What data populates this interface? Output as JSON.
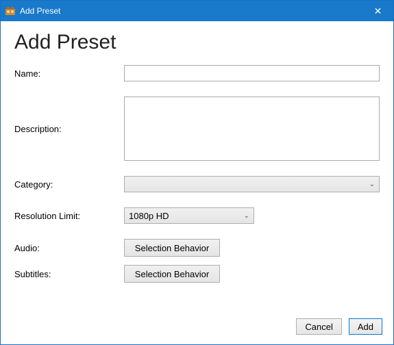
{
  "window": {
    "title": "Add Preset",
    "close_glyph": "✕"
  },
  "heading": "Add Preset",
  "labels": {
    "name": "Name:",
    "description": "Description:",
    "category": "Category:",
    "resolution_limit": "Resolution Limit:",
    "audio": "Audio:",
    "subtitles": "Subtitles:"
  },
  "fields": {
    "name_value": "",
    "description_value": "",
    "category_value": "",
    "resolution_limit_value": "1080p HD",
    "audio_button": "Selection Behavior",
    "subtitles_button": "Selection Behavior"
  },
  "footer": {
    "cancel": "Cancel",
    "add": "Add"
  },
  "icons": {
    "chevron": "⌄"
  }
}
